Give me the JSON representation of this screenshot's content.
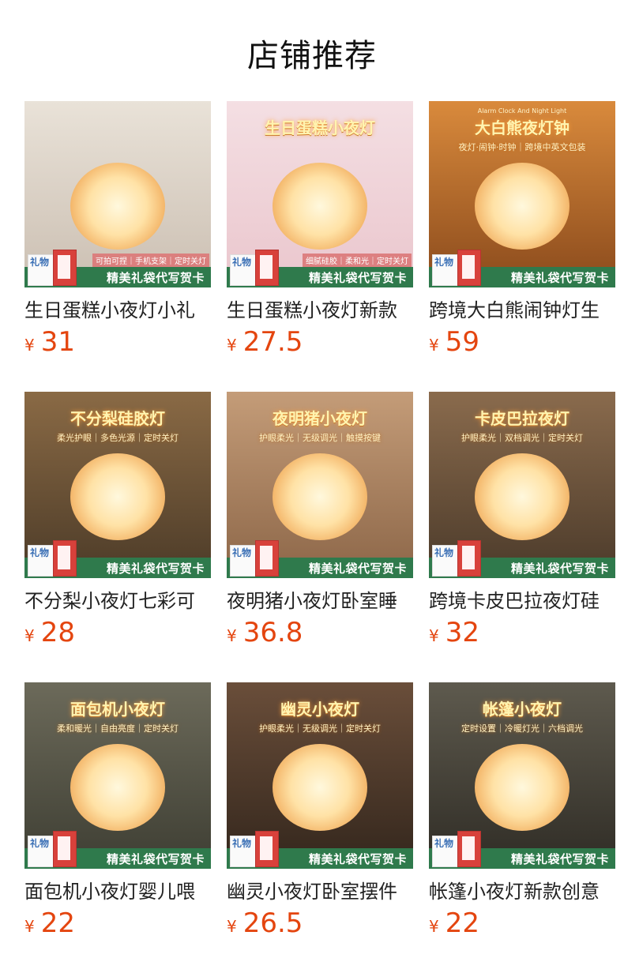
{
  "page": {
    "title": "店铺推荐"
  },
  "banner_text": "精美礼袋代写贺卡",
  "bag_text": "礼物",
  "products": [
    {
      "name": "生日蛋糕小夜灯小礼",
      "currency": "¥",
      "price": "31",
      "img": {
        "headline": "",
        "sub": "",
        "en": "",
        "feature": "可拍可捏｜手机支架｜定时关灯",
        "colors": [
          "#e9e2d8",
          "#cbbfb2"
        ]
      }
    },
    {
      "name": "生日蛋糕小夜灯新款",
      "currency": "¥",
      "price": "27.5",
      "img": {
        "headline": "生日蛋糕小夜灯",
        "sub": "",
        "en": "",
        "feature": "细腻硅胶｜柔和光｜定时关灯",
        "colors": [
          "#f4dfe3",
          "#eac6cd"
        ]
      }
    },
    {
      "name": "跨境大白熊闹钟灯生",
      "currency": "¥",
      "price": "59",
      "img": {
        "headline": "大白熊夜灯钟",
        "sub": "夜灯·闹钟·时钟｜跨境中英文包装",
        "en": "Alarm Clock And Night Light",
        "feature": "",
        "colors": [
          "#d98a3c",
          "#8a4a1c"
        ]
      }
    },
    {
      "name": "不分梨小夜灯七彩可",
      "currency": "¥",
      "price": "28",
      "img": {
        "headline": "不分梨硅胶灯",
        "sub": "柔光护眼｜多色光源｜定时关灯",
        "en": "",
        "feature": "",
        "colors": [
          "#8a6a45",
          "#4c3b28"
        ]
      }
    },
    {
      "name": "夜明猪小夜灯卧室睡",
      "currency": "¥",
      "price": "36.8",
      "img": {
        "headline": "夜明猪小夜灯",
        "sub": "护眼柔光｜无级调光｜触摸按键",
        "en": "",
        "feature": "",
        "colors": [
          "#c49c78",
          "#8c6648"
        ]
      }
    },
    {
      "name": "跨境卡皮巴拉夜灯硅",
      "currency": "¥",
      "price": "32",
      "img": {
        "headline": "卡皮巴拉夜灯",
        "sub": "护眼柔光｜双档调光｜定时关灯",
        "en": "",
        "feature": "",
        "colors": [
          "#8a6b4d",
          "#4b3a2a"
        ]
      }
    },
    {
      "name": "面包机小夜灯婴儿喂",
      "currency": "¥",
      "price": "22",
      "img": {
        "headline": "面包机小夜灯",
        "sub": "柔和暖光｜自由亮度｜定时关灯",
        "en": "",
        "feature": "",
        "colors": [
          "#6c6a5a",
          "#3e3e33"
        ]
      }
    },
    {
      "name": "幽灵小夜灯卧室摆件",
      "currency": "¥",
      "price": "26.5",
      "img": {
        "headline": "幽灵小夜灯",
        "sub": "护眼柔光｜无级调光｜定时关灯",
        "en": "",
        "feature": "",
        "colors": [
          "#6a4e3a",
          "#33261c"
        ]
      }
    },
    {
      "name": "帐篷小夜灯新款创意",
      "currency": "¥",
      "price": "22",
      "img": {
        "headline": "帐篷小夜灯",
        "sub": "定时设置｜冷暖灯光｜六档调光",
        "en": "",
        "feature": "",
        "colors": [
          "#5e5a4e",
          "#2f2c25"
        ]
      }
    }
  ]
}
